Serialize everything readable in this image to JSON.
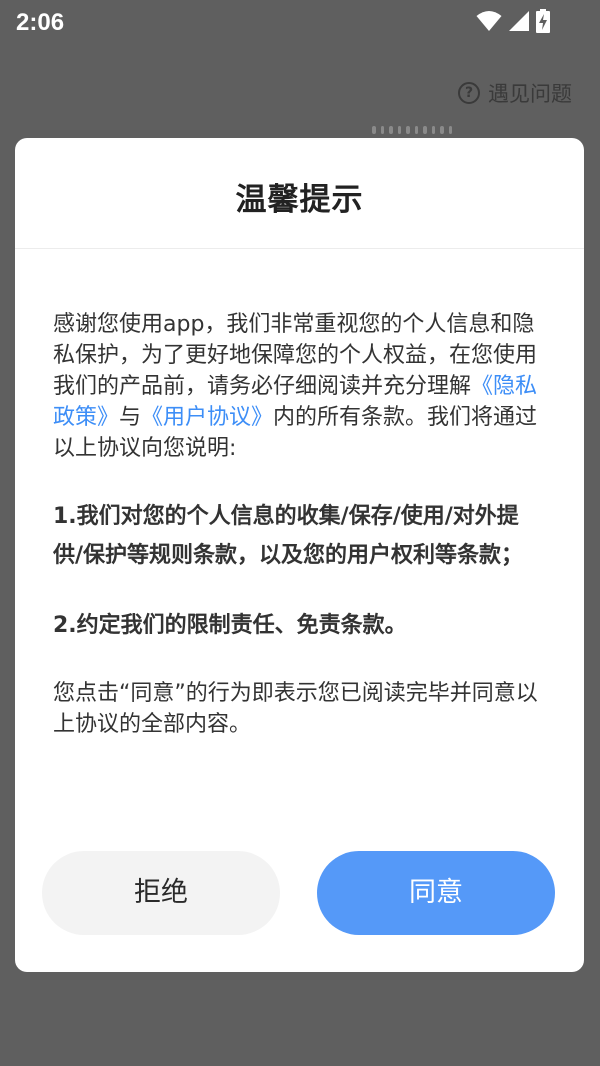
{
  "status_bar": {
    "time": "2:06",
    "icons": [
      "wifi-icon",
      "signal-icon",
      "battery-charging-icon"
    ]
  },
  "background": {
    "help_label": "遇见问题",
    "help_icon": "question-circle-icon"
  },
  "dialog": {
    "title": "温馨提示",
    "intro_prefix": "感谢您使用app，我们非常重视您的个人信息和隐私保护，为了更好地保障您的个人权益，在您使用我们的产品前，请务必仔细阅读并充分理解",
    "privacy_link": "《隐私政策》",
    "connector": "与",
    "agreement_link": "《用户协议》",
    "intro_suffix": "内的所有条款。我们将通过以上协议向您说明:",
    "point_1": "1.我们对您的个人信息的收集/保存/使用/对外提供/保护等规则条款，以及您的用户权利等条款；",
    "point_2": "2.约定我们的限制责任、免责条款。",
    "closing": "您点击“同意”的行为即表示您已阅读完毕并同意以上协议的全部内容。",
    "refuse_label": "拒绝",
    "agree_label": "同意"
  },
  "colors": {
    "link": "#3d8ef7",
    "agree_button": "#5599f8",
    "refuse_button": "#f3f3f3",
    "overlay": "#5f5f5f"
  }
}
